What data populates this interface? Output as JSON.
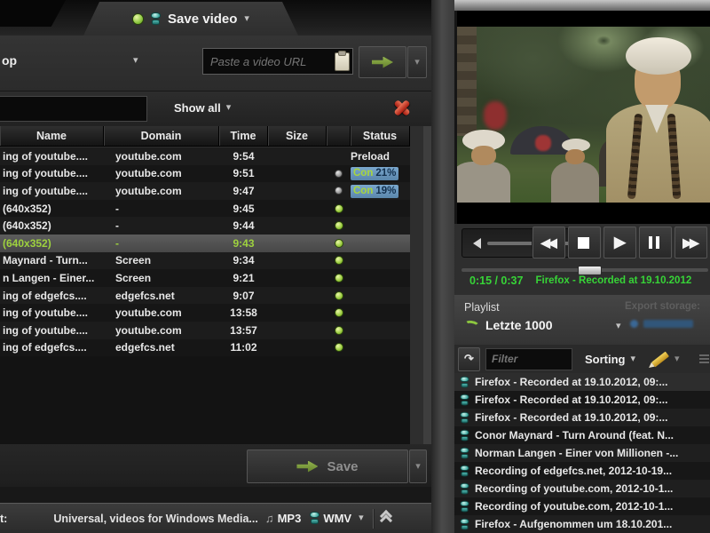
{
  "colors": {
    "accent_green": "#8dc63f",
    "status_green": "#37d437",
    "chip_blue": "#6896bd"
  },
  "left_panel": {
    "tab": {
      "label": "Save video"
    },
    "toolbar": {
      "source_label": "op",
      "url_placeholder": "Paste a video URL"
    },
    "filter_bar": {
      "show_all_label": "Show all"
    },
    "table": {
      "headers": {
        "name": "Name",
        "domain": "Domain",
        "time": "Time",
        "size": "Size",
        "status": "Status"
      },
      "rows": [
        {
          "name": "ing of  youtube....",
          "domain": "youtube.com",
          "time": "9:54",
          "size": "",
          "dot": "none",
          "status_kind": "text",
          "status_text": "Preload"
        },
        {
          "name": "ing of  youtube....",
          "domain": "youtube.com",
          "time": "9:51",
          "size": "",
          "dot": "gray",
          "status_kind": "chip",
          "chip_label": "Con",
          "chip_pct": "21%"
        },
        {
          "name": "ing of  youtube....",
          "domain": "youtube.com",
          "time": "9:47",
          "size": "",
          "dot": "gray",
          "status_kind": "chip",
          "chip_label": "Con",
          "chip_pct": "19%"
        },
        {
          "name": "(640x352)",
          "domain": "-",
          "time": "9:45",
          "size": "",
          "dot": "green",
          "status_kind": "none"
        },
        {
          "name": "(640x352)",
          "domain": "-",
          "time": "9:44",
          "size": "",
          "dot": "green",
          "status_kind": "none"
        },
        {
          "name": "(640x352)",
          "domain": "-",
          "time": "9:43",
          "size": "",
          "dot": "green",
          "status_kind": "none",
          "selected": true
        },
        {
          "name": "Maynard - Turn...",
          "domain": "Screen",
          "time": "9:34",
          "size": "",
          "dot": "green",
          "status_kind": "none"
        },
        {
          "name": "n Langen - Einer...",
          "domain": "Screen",
          "time": "9:21",
          "size": "",
          "dot": "green",
          "status_kind": "none"
        },
        {
          "name": "ing of  edgefcs....",
          "domain": "edgefcs.net",
          "time": "9:07",
          "size": "",
          "dot": "green",
          "status_kind": "none"
        },
        {
          "name": "ing of  youtube....",
          "domain": "youtube.com",
          "time": "13:58",
          "size": "",
          "dot": "green",
          "status_kind": "none"
        },
        {
          "name": "ing of  youtube....",
          "domain": "youtube.com",
          "time": "13:57",
          "size": "",
          "dot": "green",
          "status_kind": "none"
        },
        {
          "name": "ing of  edgefcs....",
          "domain": "edgefcs.net",
          "time": "11:02",
          "size": "",
          "dot": "green",
          "status_kind": "none"
        }
      ]
    },
    "save": {
      "label": "Save"
    },
    "bottom_bar": {
      "left_label": "t:",
      "format_text": "Universal, videos for Windows Media...",
      "note_icon": "♫",
      "mp3_label": "MP3",
      "wmv_label": "WMV"
    }
  },
  "right_panel": {
    "player": {
      "time_display": "0:15 / 0:37",
      "now_playing": "Firefox - Recorded at 19.10.2012"
    },
    "playlist": {
      "section_label": "Playlist",
      "name": "Letzte 1000",
      "export_label": "Export storage:",
      "filter_placeholder": "Filter",
      "sorting_label": "Sorting",
      "items": [
        {
          "title": "Firefox - Recorded at 19.10.2012, 09:..."
        },
        {
          "title": "Firefox - Recorded at 19.10.2012, 09:..."
        },
        {
          "title": "Firefox - Recorded at 19.10.2012, 09:..."
        },
        {
          "title": "Conor Maynard - Turn Around (feat. N..."
        },
        {
          "title": "Norman Langen - Einer von Millionen -..."
        },
        {
          "title": "Recording of  edgefcs.net, 2012-10-19..."
        },
        {
          "title": "Recording of  youtube.com, 2012-10-1..."
        },
        {
          "title": "Recording of  youtube.com, 2012-10-1..."
        },
        {
          "title": "Firefox - Aufgenommen um 18.10.201..."
        }
      ]
    }
  }
}
